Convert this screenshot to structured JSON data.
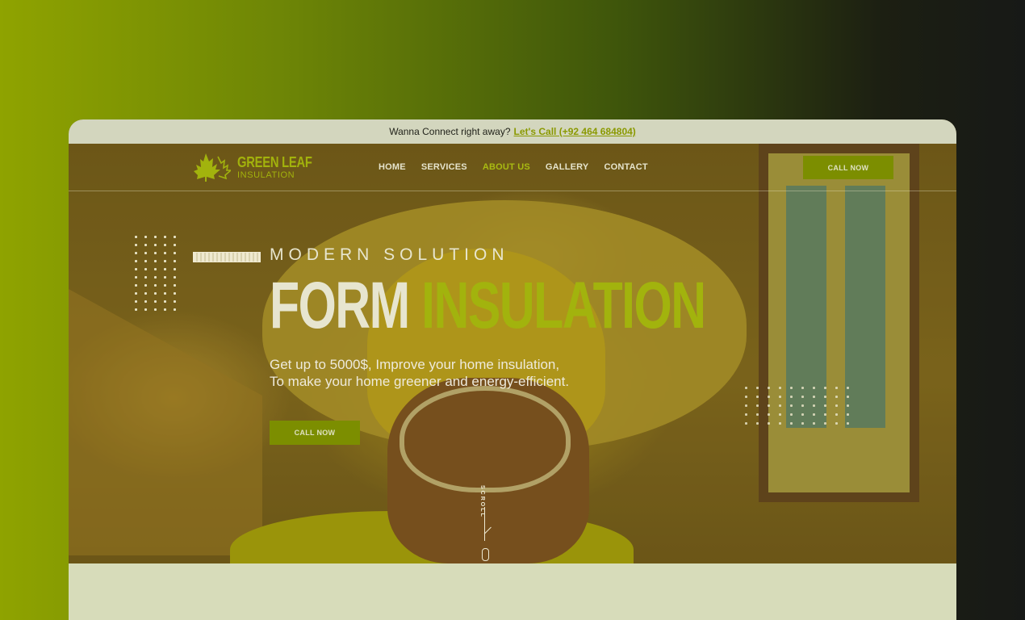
{
  "topbar": {
    "prompt": "Wanna Connect right away?",
    "call_link": "Let's Call (+92 464 684804)"
  },
  "brand": {
    "name_line1": "GREEN LEAF",
    "name_line2": "INSULATION",
    "logo_icon": "maple-leaf-icon",
    "accent_color": "#a2b30d"
  },
  "nav": {
    "items": [
      {
        "label": "HOME"
      },
      {
        "label": "SERVICES"
      },
      {
        "label": "ABOUT US"
      },
      {
        "label": "GALLERY"
      },
      {
        "label": "CONTACT"
      }
    ],
    "active": "ABOUT US",
    "cta_label": "CALL NOW"
  },
  "hero": {
    "eyebrow": "MODERN SOLUTION",
    "headline_part1": "FORM",
    "headline_part2": "INSULATION",
    "subtext": "Get up to 5000$, Improve your home insulation, To make your home greener and energy-efficient.",
    "cta_label": "CALL NOW",
    "scroll_label": "SCROLL"
  }
}
